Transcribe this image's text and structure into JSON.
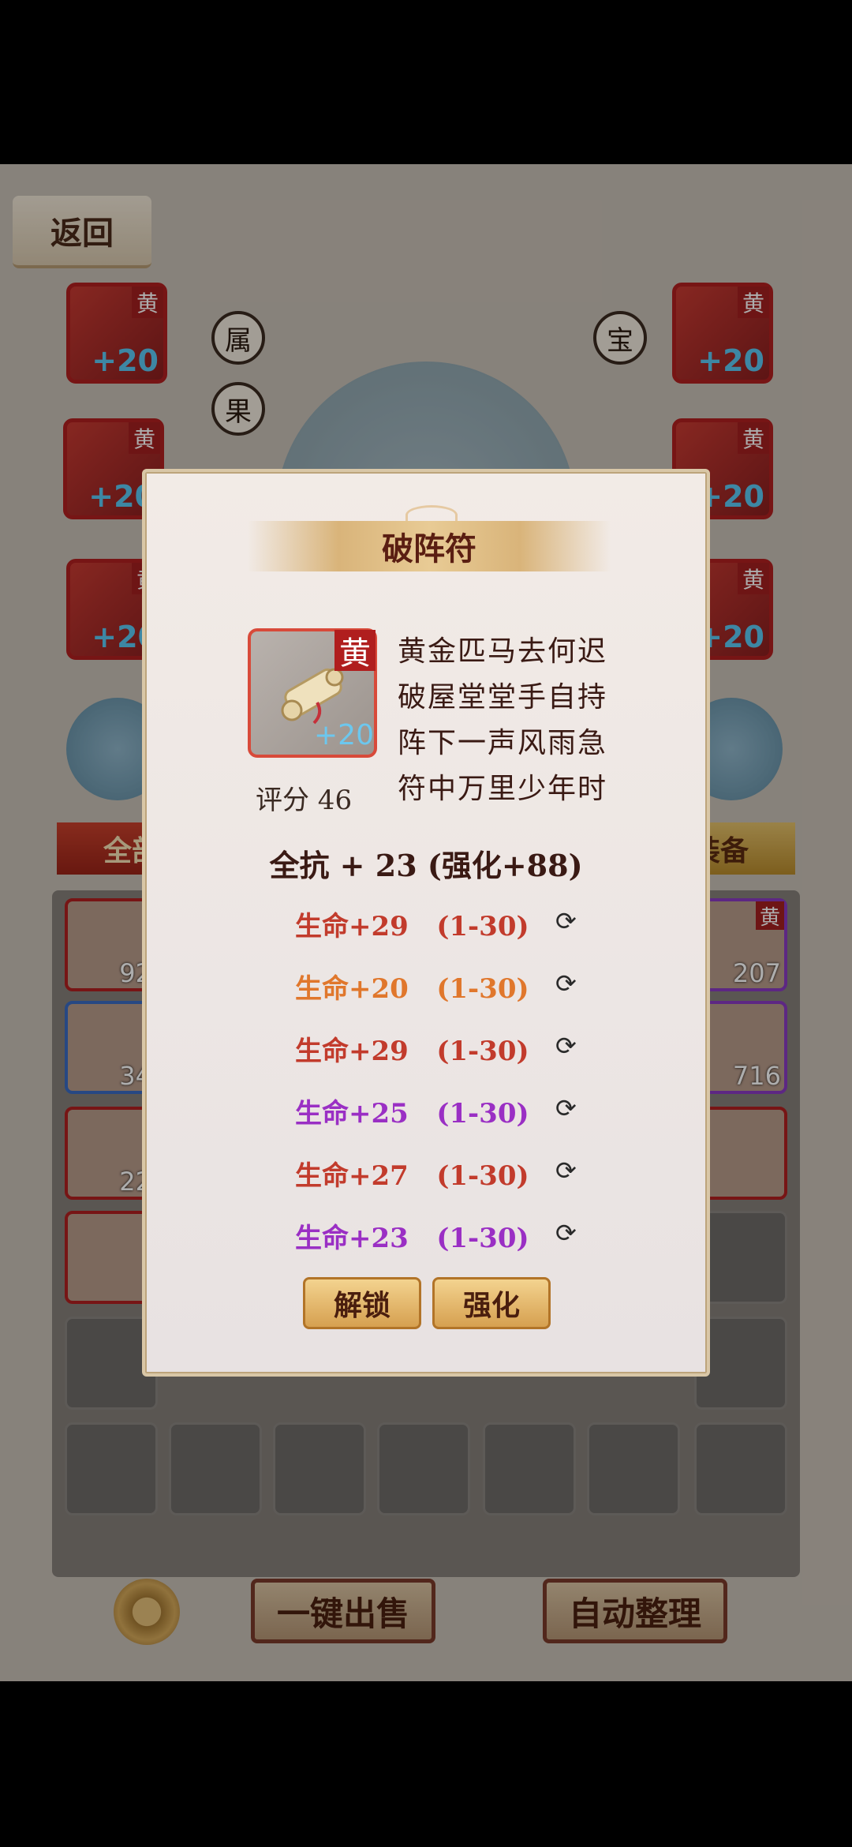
{
  "game": {
    "back_label": "返回",
    "buttons_left": [
      "属",
      "果"
    ],
    "button_right": "宝",
    "equip_slots": [
      {
        "grade": "黄",
        "plus": "+20"
      },
      {
        "grade": "黄",
        "plus": "+20"
      },
      {
        "grade": "黄",
        "plus": "+20"
      },
      {
        "grade": "黄",
        "plus": "+20"
      },
      {
        "grade": "黄",
        "plus": "+20"
      },
      {
        "grade": "黄",
        "plus": "+20"
      }
    ],
    "tabs": {
      "left": "全部",
      "right": "装备"
    },
    "inventory_counts": {
      "a": "92",
      "b": "34",
      "c": "22",
      "d": "207",
      "e": "716"
    },
    "inventory_grade": "黄",
    "sell_label": "一键出售",
    "sort_label": "自动整理"
  },
  "dialog": {
    "title": "破阵符",
    "item": {
      "grade": "黄",
      "plus": "+20"
    },
    "score_label": "评分 46",
    "poem": [
      "黄金匹马去何迟",
      "破屋堂堂手自持",
      "阵下一声风雨急",
      "符中万里少年时"
    ],
    "main_stat": "全抗 + 23  (强化+88)",
    "sub_stats": [
      {
        "text": "生命+29   (1-30)",
        "color": "#c23b2c"
      },
      {
        "text": "生命+20   (1-30)",
        "color": "#e0772c"
      },
      {
        "text": "生命+29   (1-30)",
        "color": "#c23b2c"
      },
      {
        "text": "生命+25   (1-30)",
        "color": "#9a2fc4"
      },
      {
        "text": "生命+27   (1-30)",
        "color": "#c23b2c"
      },
      {
        "text": "生命+23   (1-30)",
        "color": "#9a2fc4"
      }
    ],
    "unlock_label": "解锁",
    "enhance_label": "强化"
  }
}
